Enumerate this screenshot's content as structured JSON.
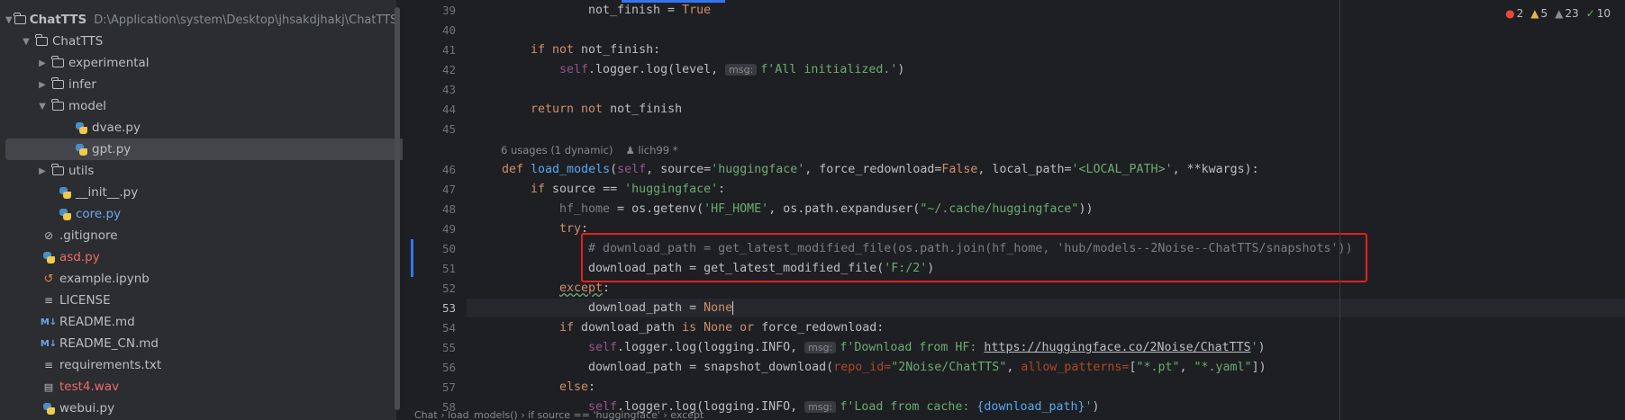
{
  "project": {
    "root_name": "ChatTTS",
    "root_path": "D:\\Application\\system\\Desktop\\jhsakdjhakj\\ChatTTS",
    "items": [
      {
        "label": "ChatTTS",
        "icon": "folder-icon"
      },
      {
        "label": "experimental",
        "icon": "folder-icon"
      },
      {
        "label": "infer",
        "icon": "folder-icon"
      },
      {
        "label": "model",
        "icon": "folder-icon"
      },
      {
        "label": "dvae.py",
        "icon": "python-file-icon"
      },
      {
        "label": "gpt.py",
        "icon": "python-file-icon"
      },
      {
        "label": "utils",
        "icon": "folder-icon"
      },
      {
        "label": "__init__.py",
        "icon": "python-file-icon"
      },
      {
        "label": "core.py",
        "icon": "python-file-icon"
      },
      {
        "label": ".gitignore",
        "icon": "gitignore-icon"
      },
      {
        "label": "asd.py",
        "icon": "python-file-icon"
      },
      {
        "label": "example.ipynb",
        "icon": "notebook-icon"
      },
      {
        "label": "LICENSE",
        "icon": "text-file-icon"
      },
      {
        "label": "README.md",
        "icon": "markdown-icon"
      },
      {
        "label": "README_CN.md",
        "icon": "markdown-icon"
      },
      {
        "label": "requirements.txt",
        "icon": "text-file-icon"
      },
      {
        "label": "test4.wav",
        "icon": "audio-file-icon"
      },
      {
        "label": "webui.py",
        "icon": "python-file-icon"
      }
    ]
  },
  "inspections": {
    "errors": "2",
    "warnings": "5",
    "weak_warnings": "23",
    "ok": "10"
  },
  "editor": {
    "line_numbers": [
      "39",
      "40",
      "41",
      "42",
      "43",
      "44",
      "45",
      "46",
      "47",
      "48",
      "49",
      "50",
      "51",
      "52",
      "53",
      "54",
      "55",
      "56",
      "57",
      "58"
    ],
    "usages": "6 usages (1 dynamic)",
    "author": "lich99 *",
    "hints": {
      "msg": "msg:",
      "repo_id": "repo_id=",
      "allow_patterns": "allow_patterns="
    },
    "code": {
      "l39_a": "not_finish = ",
      "l39_b": "True",
      "l41_a": "if not ",
      "l41_b": "not_finish:",
      "l42_self": "self",
      "l42_a": ".logger.log(level, ",
      "l42_str": "f'All initialized.'",
      "l42_b": ")",
      "l44_kw": "return not ",
      "l44_b": "not_finish",
      "l46_def": "def ",
      "l46_fn": "load_models",
      "l46_a": "(",
      "l46_self": "self",
      "l46_b": ", source=",
      "l46_s1": "'huggingface'",
      "l46_c": ", force_redownload=",
      "l46_false": "False",
      "l46_d": ", local_path=",
      "l46_s2": "'<LOCAL_PATH>'",
      "l46_e": ", **kwargs):",
      "l47_if": "if ",
      "l47_a": "source == ",
      "l47_s": "'huggingface'",
      "l47_b": ":",
      "l48_a": "hf_home",
      "l48_b": " = os.getenv(",
      "l48_s1": "'HF_HOME'",
      "l48_c": ", os.path.expanduser(",
      "l48_s2": "\"~/.cache/huggingface\"",
      "l48_d": "))",
      "l49_try": "try",
      "l49_b": ":",
      "l50_cmt": "# download_path = get_latest_modified_file(os.path.join(hf_home, 'hub/models--2Noise--ChatTTS/snapshots'))",
      "l51_a": "download_path = get_latest_modified_file(",
      "l51_s": "'F:/2'",
      "l51_b": ")",
      "l52_except": "except",
      "l52_b": ":",
      "l53_a": "download_path = ",
      "l53_none": "None",
      "l54_if": "if ",
      "l54_a": "download_path ",
      "l54_is": "is ",
      "l54_none": "None ",
      "l54_or": "or ",
      "l54_b": "force_redownload:",
      "l55_self": "self",
      "l55_a": ".logger.log(logging.INFO, ",
      "l55_s1": "f'Download from HF: ",
      "l55_url": "https://huggingface.co/2Noise/ChatTTS",
      "l55_s2": "'",
      "l55_b": ")",
      "l56_a": "download_path = snapshot_download(",
      "l56_s1": "\"2Noise/ChatTTS\"",
      "l56_b": ", ",
      "l56_c": "[",
      "l56_s2": "\"*.pt\"",
      "l56_d": ", ",
      "l56_s3": "\"*.yaml\"",
      "l56_e": "])",
      "l57_else": "else",
      "l57_b": ":",
      "l58_self": "self",
      "l58_a": ".logger.log(logging.INFO, ",
      "l58_s1": "f'Load from cache: ",
      "l58_b": "{download_path}",
      "l58_s2": "'",
      "l58_c": ")"
    }
  },
  "breadcrumb": {
    "items": [
      "Chat",
      "load_models()",
      "if source == 'huggingface'",
      "except"
    ]
  }
}
